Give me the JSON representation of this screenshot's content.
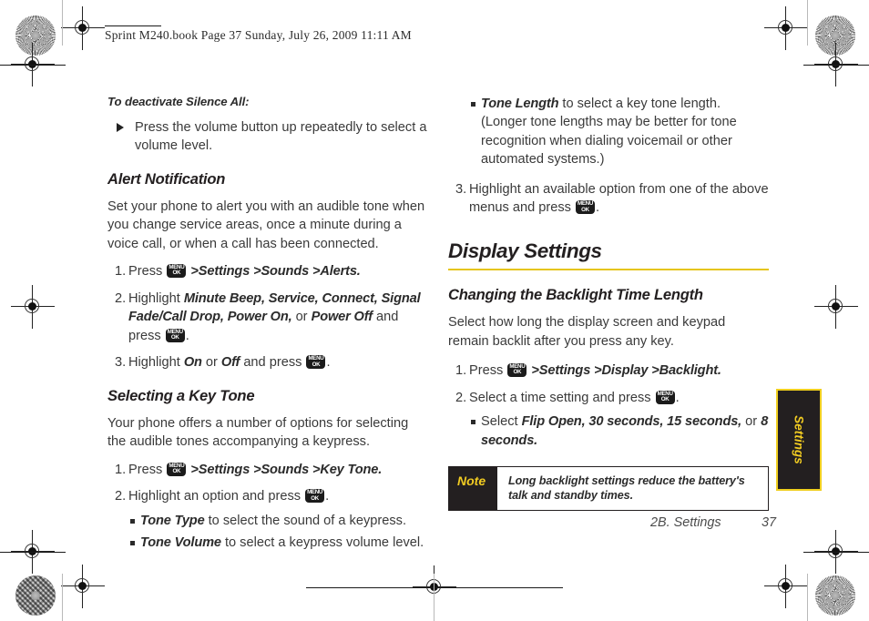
{
  "header": {
    "slug": "Sprint M240.book  Page 37  Sunday, July 26, 2009  11:11 AM"
  },
  "key_glyph": {
    "line1": "MENU",
    "line2": "OK"
  },
  "left_column": {
    "lead_in": "To deactivate Silence All:",
    "arrow_item": "Press the volume button up repeatedly to select a volume level.",
    "section_alert": {
      "heading": "Alert Notification",
      "intro": "Set your phone to alert you with an audible tone when you change service areas, once a minute during a voice call, or when a call has been connected.",
      "steps": [
        {
          "num": "1.",
          "pre": "Press ",
          "path": ">Settings >Sounds >Alerts.",
          "post": ""
        },
        {
          "num": "2.",
          "pre": "Highlight ",
          "italic": "Minute Beep, Service, Connect, Signal Fade/Call Drop, Power On,",
          "mid": " or ",
          "italic2": "Power Off",
          "post": " and press "
        },
        {
          "num": "3.",
          "pre": "Highlight ",
          "italic": "On",
          "mid": " or ",
          "italic2": "Off",
          "post": " and press "
        }
      ]
    },
    "section_keytone": {
      "heading": "Selecting a Key Tone",
      "intro": "Your phone offers a number of options for selecting the audible tones accompanying a keypress.",
      "step1": {
        "num": "1.",
        "pre": "Press ",
        "path": ">Settings >Sounds >Key Tone."
      },
      "step2": {
        "num": "2.",
        "pre": "Highlight an option and press ",
        "post": "."
      },
      "bullets": [
        {
          "term": "Tone Type",
          "text": " to select the sound of a keypress."
        },
        {
          "term": "Tone Volume",
          "text": " to select a keypress volume level."
        }
      ]
    }
  },
  "right_column": {
    "tone_length_bullet": {
      "term": "Tone Length",
      "text": " to select a key tone length. (Longer tone lengths may be better for tone recognition when dialing voicemail or other automated systems.)"
    },
    "step3": {
      "num": "3.",
      "text": "Highlight an available option from one of the above menus and press ",
      "post": "."
    },
    "chapter_heading": "Display Settings",
    "section_backlight": {
      "heading": "Changing the Backlight Time Length",
      "intro": "Select how long the display screen and keypad remain backlit after you press any key.",
      "step1": {
        "num": "1.",
        "pre": "Press ",
        "path": ">Settings >Display >Backlight."
      },
      "step2": {
        "num": "2.",
        "pre": "Select a time setting and press ",
        "post": "."
      },
      "bullet": {
        "pre": "Select ",
        "italic": "Flip Open, 30 seconds, 15 seconds,",
        "mid": " or ",
        "italic2": "8 seconds."
      }
    },
    "note": {
      "label": "Note",
      "text": "Long backlight settings reduce the battery's talk and standby times."
    }
  },
  "thumb_tab": {
    "label": "Settings"
  },
  "footer": {
    "chapter": "2B. Settings",
    "page": "37"
  },
  "colors": {
    "accent_yellow": "#e5c518",
    "note_yellow": "#f2cc22",
    "ink": "#231f20",
    "body_text": "#3a3a3a"
  }
}
